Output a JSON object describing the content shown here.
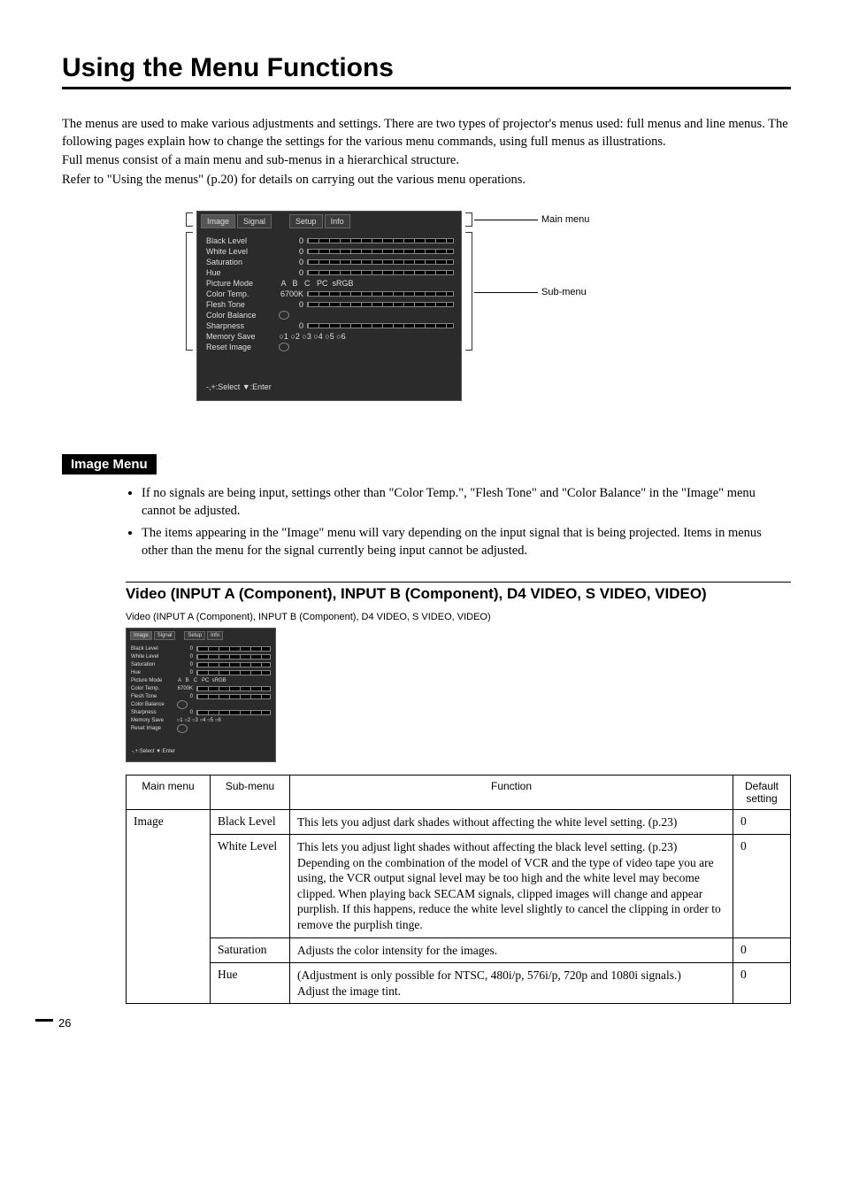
{
  "title": "Using the Menu Functions",
  "intro": {
    "p1": "The menus are used to make various adjustments and settings. There are two types of projector's menus used: full menus and line menus. The following pages explain how to change the settings for the various menu commands, using full menus as illustrations.",
    "p2": "Full menus consist of a main menu and sub-menus in a hierarchical structure.",
    "p3": "Refer to \"Using the menus\" (p.20) for details on carrying out the various menu operations."
  },
  "diagram": {
    "callout_main": "Main menu",
    "callout_sub": "Sub-menu"
  },
  "osd": {
    "tabs": [
      "Image",
      "Signal",
      "Setup",
      "Info"
    ],
    "rows": [
      {
        "label": "Black Level",
        "val": "0",
        "type": "bar"
      },
      {
        "label": "White Level",
        "val": "0",
        "type": "bar"
      },
      {
        "label": "Saturation",
        "val": "0",
        "type": "bar"
      },
      {
        "label": "Hue",
        "val": "0",
        "type": "bar"
      },
      {
        "label": "Picture Mode",
        "val": "",
        "type": "mode",
        "mode": "A   B   C   PC  sRGB"
      },
      {
        "label": "Color Temp.",
        "val": "6700K",
        "type": "bar"
      },
      {
        "label": "Flesh Tone",
        "val": "0",
        "type": "bar"
      },
      {
        "label": "Color Balance",
        "val": "",
        "type": "go"
      },
      {
        "label": "Sharpness",
        "val": "0",
        "type": "bar"
      },
      {
        "label": "Memory Save",
        "val": "",
        "type": "mem",
        "mem": "○1 ○2 ○3 ○4 ○5 ○6"
      },
      {
        "label": "Reset Image",
        "val": "",
        "type": "go"
      }
    ],
    "footer": "-,+:Select  ▼:Enter"
  },
  "section_image": "Image Menu",
  "notes": [
    "If no signals are being input, settings other than \"Color Temp.\", \"Flesh Tone\" and \"Color Balance\" in the \"Image\" menu cannot be adjusted.",
    "The items appearing in the \"Image\" menu will vary depending on the input signal that is being projected. Items in menus other than the menu for the signal currently being input cannot be adjusted."
  ],
  "subhead": "Video (INPUT A (Component), INPUT B (Component), D4 VIDEO, S VIDEO, VIDEO)",
  "caption": "Video (INPUT A (Component), INPUT B (Component), D4 VIDEO, S VIDEO, VIDEO)",
  "table": {
    "headers": {
      "main": "Main menu",
      "sub": "Sub-menu",
      "func": "Function",
      "def": "Default setting"
    },
    "main_label": "Image",
    "rows": [
      {
        "sub": "Black Level",
        "func": "This lets you adjust dark shades without affecting the white level setting. (p.23)",
        "def": "0"
      },
      {
        "sub": "White Level",
        "func": "This lets you adjust light shades without affecting the black level setting. (p.23)\nDepending on the combination of the model of VCR and the type of video tape you are using, the VCR output signal level may be too high and the white level may become clipped. When playing back SECAM signals, clipped images will change and appear purplish. If this happens, reduce the white level slightly to cancel the clipping in order to remove the purplish tinge.",
        "def": "0"
      },
      {
        "sub": "Saturation",
        "func": "Adjusts the color intensity for the images.",
        "def": "0"
      },
      {
        "sub": "Hue",
        "func": "(Adjustment is only possible for NTSC, 480i/p, 576i/p, 720p and 1080i signals.)\nAdjust the image tint.",
        "def": "0"
      }
    ]
  },
  "page_num": "26"
}
